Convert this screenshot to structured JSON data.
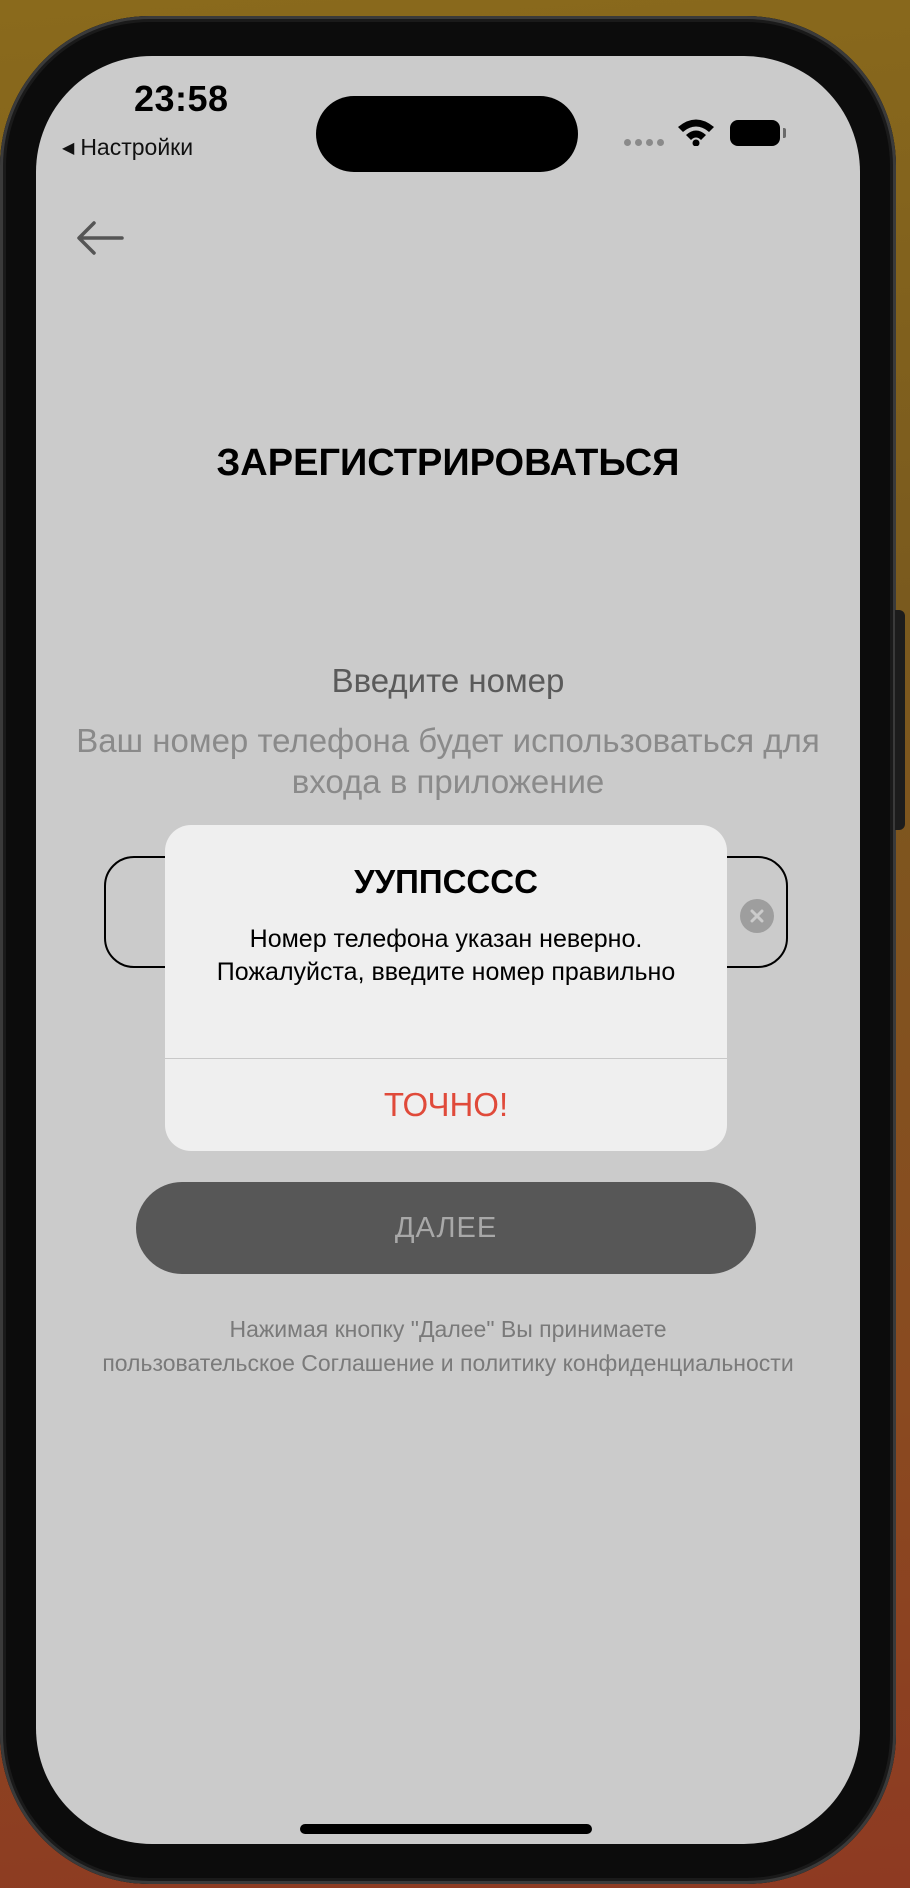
{
  "status_bar": {
    "time": "23:58",
    "back_app_label": "Настройки"
  },
  "icons": {
    "back": "arrow-left-icon",
    "clear": "clear-circle-icon",
    "wifi": "wifi-icon",
    "battery": "battery-icon",
    "signal": "cellular-signal-icon"
  },
  "screen": {
    "title": "ЗАРЕГИСТРИРОВАТЬСЯ",
    "subtitle": "Введите номер",
    "hint": "Ваш номер телефона будет использоваться для входа в приложение",
    "phone_input_value": "",
    "next_button_label": "ДАЛЕЕ",
    "legal_text_line1": "Нажимая кнопку \"Далее\"  Вы принимаете",
    "legal_text_line2": "пользовательское Соглашение и политику конфиденциальности"
  },
  "alert": {
    "title": "УУППСССС",
    "message": "Номер телефона указан неверно. Пожалуйста, введите номер правильно",
    "button_label": "ТОЧНО!"
  },
  "colors": {
    "screen_bg": "#cbcbcb",
    "alert_bg": "#efefef",
    "alert_action": "#e04a3a",
    "next_button_bg": "#575757"
  }
}
